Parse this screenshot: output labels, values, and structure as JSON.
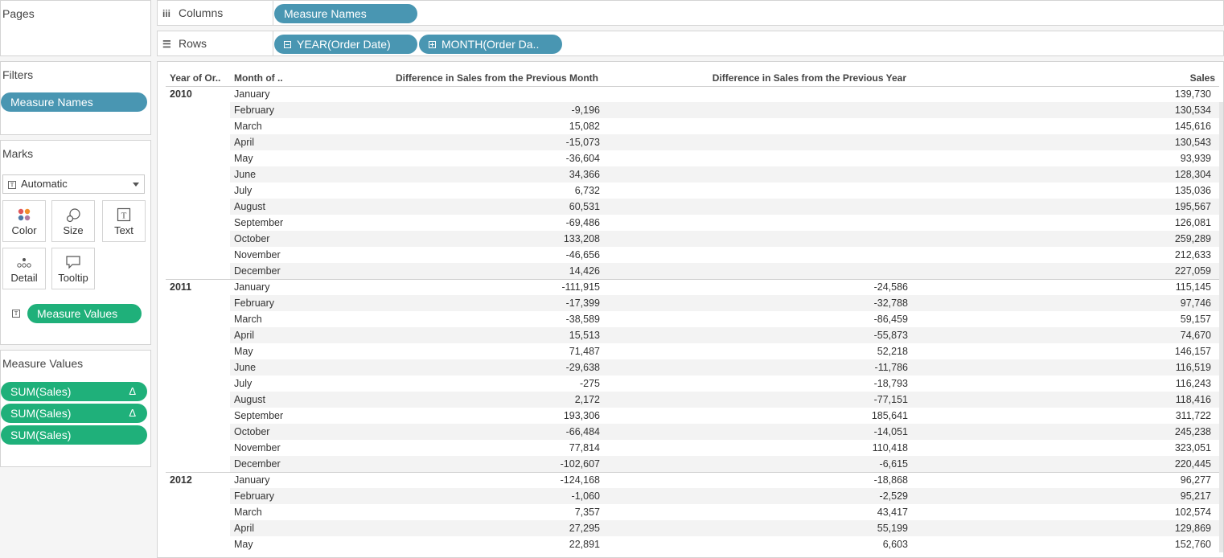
{
  "cards": {
    "pages": {
      "title": "Pages"
    },
    "filters": {
      "title": "Filters",
      "pills": [
        "Measure Names"
      ]
    },
    "marks": {
      "title": "Marks",
      "mark_type": "Automatic",
      "buttons": [
        "Color",
        "Size",
        "Text",
        "Detail",
        "Tooltip"
      ],
      "pill": "Measure Values"
    },
    "measure_values": {
      "title": "Measure Values",
      "pills": [
        {
          "label": "SUM(Sales)",
          "delta": "Δ"
        },
        {
          "label": "SUM(Sales)",
          "delta": "Δ"
        },
        {
          "label": "SUM(Sales)",
          "delta": ""
        }
      ]
    }
  },
  "shelves": {
    "columns": {
      "label": "Columns",
      "pills": [
        "Measure Names"
      ]
    },
    "rows": {
      "label": "Rows",
      "pills": [
        "YEAR(Order Date)",
        "MONTH(Order Da.."
      ]
    }
  },
  "table": {
    "headers": [
      "Year of Or..",
      "Month of ..",
      "Difference in Sales from the Previous Month",
      "Difference in Sales from the Previous Year",
      "Sales"
    ],
    "groups": [
      {
        "year": "2010",
        "rows": [
          [
            "January",
            "",
            "",
            "139,730"
          ],
          [
            "February",
            "-9,196",
            "",
            "130,534"
          ],
          [
            "March",
            "15,082",
            "",
            "145,616"
          ],
          [
            "April",
            "-15,073",
            "",
            "130,543"
          ],
          [
            "May",
            "-36,604",
            "",
            "93,939"
          ],
          [
            "June",
            "34,366",
            "",
            "128,304"
          ],
          [
            "July",
            "6,732",
            "",
            "135,036"
          ],
          [
            "August",
            "60,531",
            "",
            "195,567"
          ],
          [
            "September",
            "-69,486",
            "",
            "126,081"
          ],
          [
            "October",
            "133,208",
            "",
            "259,289"
          ],
          [
            "November",
            "-46,656",
            "",
            "212,633"
          ],
          [
            "December",
            "14,426",
            "",
            "227,059"
          ]
        ]
      },
      {
        "year": "2011",
        "rows": [
          [
            "January",
            "-111,915",
            "-24,586",
            "115,145"
          ],
          [
            "February",
            "-17,399",
            "-32,788",
            "97,746"
          ],
          [
            "March",
            "-38,589",
            "-86,459",
            "59,157"
          ],
          [
            "April",
            "15,513",
            "-55,873",
            "74,670"
          ],
          [
            "May",
            "71,487",
            "52,218",
            "146,157"
          ],
          [
            "June",
            "-29,638",
            "-11,786",
            "116,519"
          ],
          [
            "July",
            "-275",
            "-18,793",
            "116,243"
          ],
          [
            "August",
            "2,172",
            "-77,151",
            "118,416"
          ],
          [
            "September",
            "193,306",
            "185,641",
            "311,722"
          ],
          [
            "October",
            "-66,484",
            "-14,051",
            "245,238"
          ],
          [
            "November",
            "77,814",
            "110,418",
            "323,051"
          ],
          [
            "December",
            "-102,607",
            "-6,615",
            "220,445"
          ]
        ]
      },
      {
        "year": "2012",
        "rows": [
          [
            "January",
            "-124,168",
            "-18,868",
            "96,277"
          ],
          [
            "February",
            "-1,060",
            "-2,529",
            "95,217"
          ],
          [
            "March",
            "7,357",
            "43,417",
            "102,574"
          ],
          [
            "April",
            "27,295",
            "55,199",
            "129,869"
          ],
          [
            "May",
            "22,891",
            "6,603",
            "152,760"
          ]
        ]
      }
    ]
  }
}
